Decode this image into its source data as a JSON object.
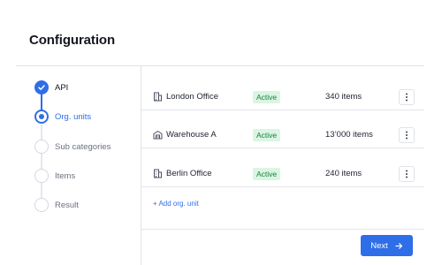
{
  "page": {
    "title": "Configuration"
  },
  "steps": [
    {
      "label": "API",
      "state": "complete"
    },
    {
      "label": "Org. units",
      "state": "current"
    },
    {
      "label": "Sub categories",
      "state": "upcoming"
    },
    {
      "label": "Items",
      "state": "upcoming"
    },
    {
      "label": "Result",
      "state": "upcoming"
    }
  ],
  "units": [
    {
      "name": "London Office",
      "icon": "building-icon",
      "status": "Active",
      "count": "340 items"
    },
    {
      "name": "Warehouse A",
      "icon": "warehouse-icon",
      "status": "Active",
      "count": "13’000 items"
    },
    {
      "name": "Berlin Office",
      "icon": "building-icon",
      "status": "Active",
      "count": "240 items"
    }
  ],
  "actions": {
    "add_unit_label": "+ Add org. unit",
    "next_label": "Next"
  },
  "colors": {
    "accent": "#2e6ee8",
    "status_bg": "#dbf5e3",
    "status_text": "#17803a"
  }
}
